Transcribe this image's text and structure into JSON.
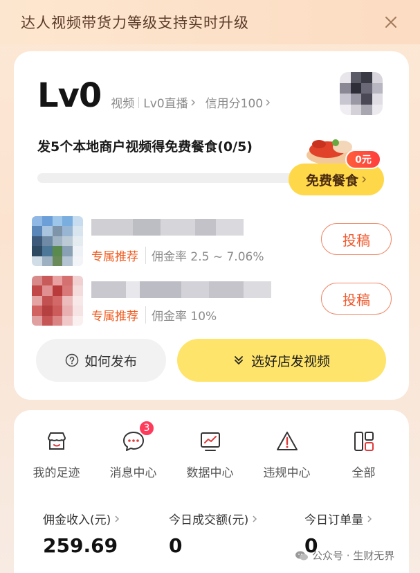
{
  "banner": {
    "text": "达人视频带货力等级支持实时升级",
    "close_icon": "close-icon"
  },
  "level_card": {
    "level": "Lv0",
    "meta": [
      "视频",
      "Lv0直播",
      "信用分100"
    ],
    "task_title": "发5个本地商户视频得免费餐食(0/5)",
    "progress": {
      "current": 0,
      "total": 5
    },
    "free_meal_label": "免费餐食",
    "coupon_label": "0元",
    "products": [
      {
        "tag": "专属推荐",
        "rate": "佣金率 2.5 ~ 7.06%",
        "post_label": "投稿"
      },
      {
        "tag": "专属推荐",
        "rate": "佣金率 10%",
        "post_label": "投稿"
      }
    ],
    "how_to_label": "如何发布",
    "pick_store_label": "选好店发视频"
  },
  "nav": {
    "items": [
      {
        "label": "我的足迹",
        "icon": "store-icon"
      },
      {
        "label": "消息中心",
        "icon": "message-icon",
        "badge": "3"
      },
      {
        "label": "数据中心",
        "icon": "chart-monitor-icon"
      },
      {
        "label": "违规中心",
        "icon": "warning-icon"
      },
      {
        "label": "全部",
        "icon": "grid-icon"
      }
    ]
  },
  "stats": [
    {
      "label": "佣金收入(元)",
      "value": "259.69"
    },
    {
      "label": "今日成交额(元)",
      "value": "0"
    },
    {
      "label": "今日订单量",
      "value": "0"
    }
  ],
  "watermark": "公众号 · 生财无界",
  "colors": {
    "accent_yellow": "#fee46a",
    "accent_orange": "#f05a1e",
    "badge_red": "#ff3b5c"
  }
}
